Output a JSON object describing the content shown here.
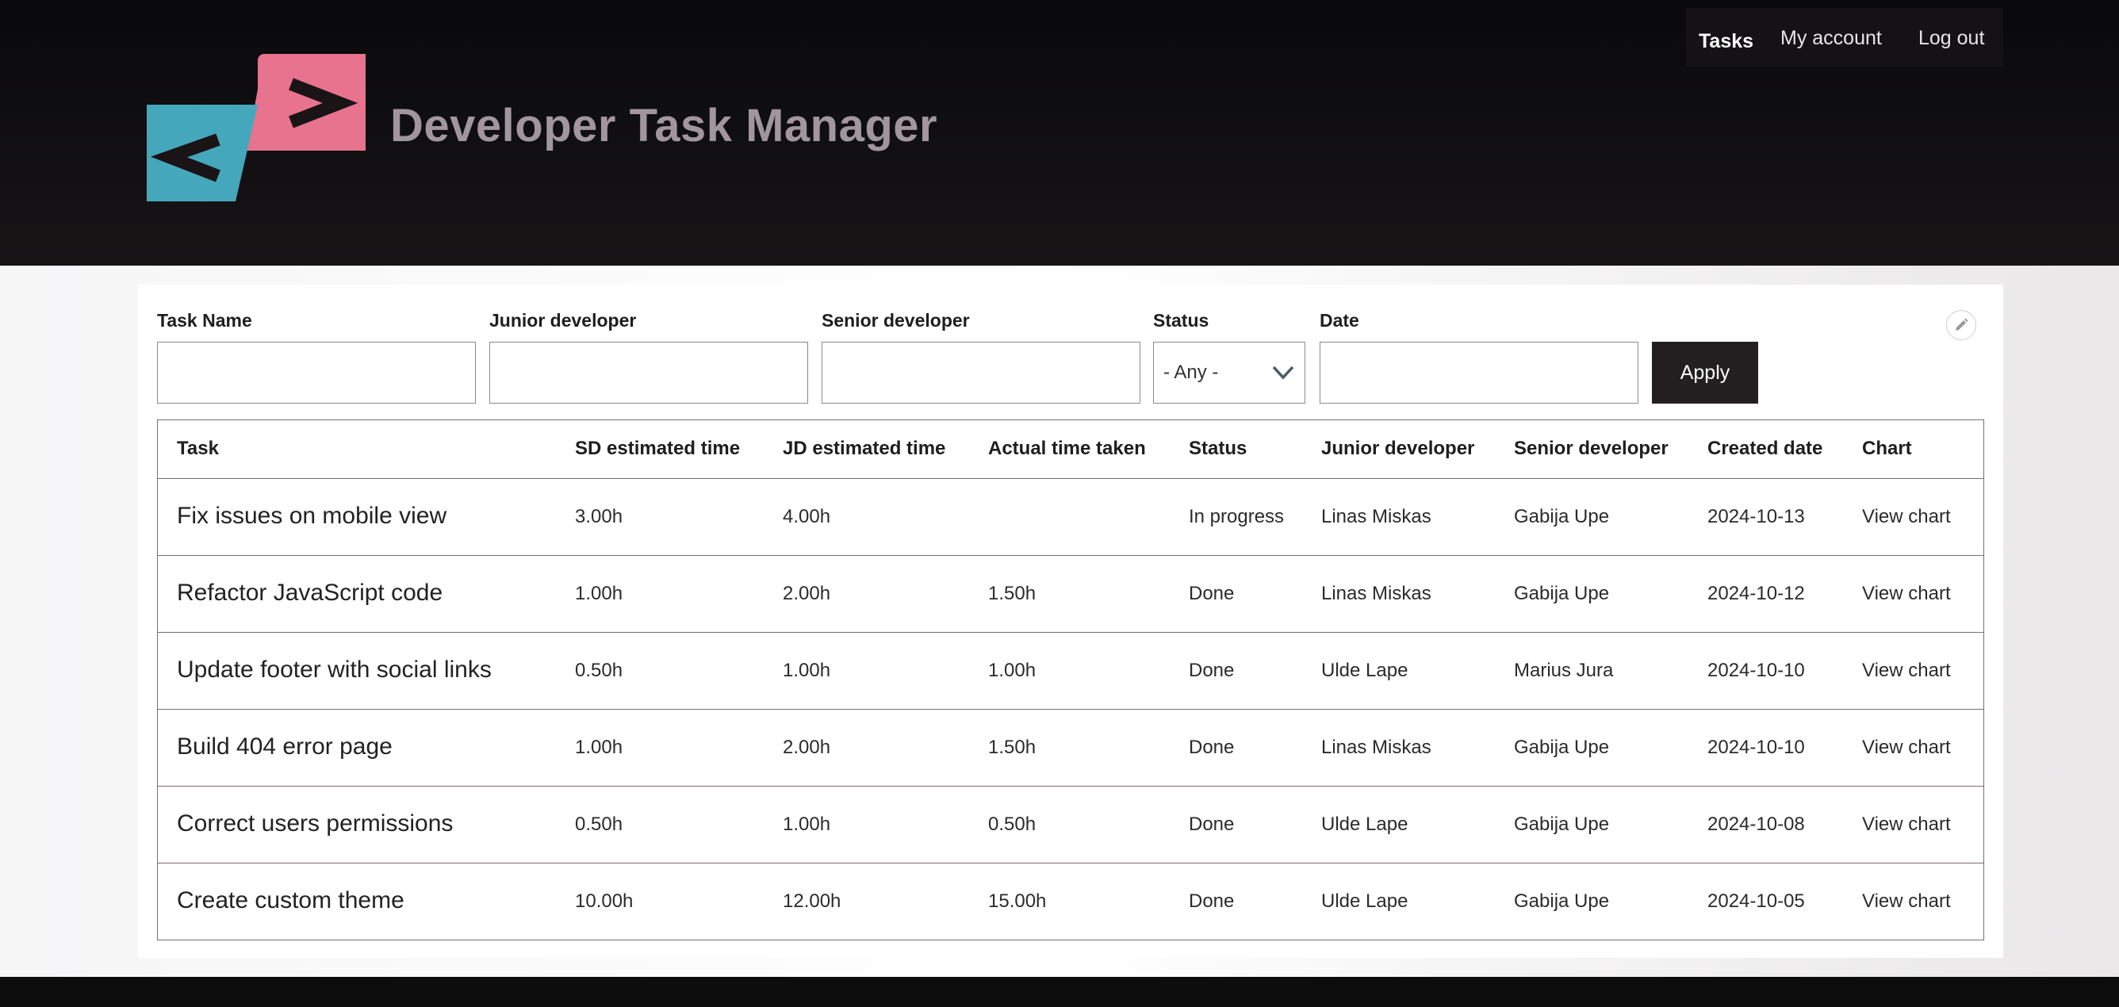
{
  "header": {
    "site_title": "Developer Task Manager",
    "logo": {
      "left_glyph": "<",
      "right_glyph": ">",
      "left_color": "#45a7bb",
      "right_color": "#e7738f"
    },
    "nav": [
      {
        "label": "Tasks",
        "active": true
      },
      {
        "label": "My account",
        "active": false
      },
      {
        "label": "Log out",
        "active": false
      }
    ]
  },
  "filters": {
    "task_name_label": "Task Name",
    "junior_label": "Junior developer",
    "senior_label": "Senior developer",
    "status_label": "Status",
    "status_value": "- Any -",
    "date_label": "Date",
    "apply_label": "Apply"
  },
  "table": {
    "headers": [
      "Task",
      "SD estimated time",
      "JD estimated time",
      "Actual time taken",
      "Status",
      "Junior developer",
      "Senior developer",
      "Created date",
      "Chart"
    ],
    "rows": [
      [
        "Fix issues on mobile view",
        "3.00h",
        "4.00h",
        "",
        "In progress",
        "Linas Miskas",
        "Gabija Upe",
        "2024-10-13",
        "View chart"
      ],
      [
        "Refactor JavaScript code",
        "1.00h",
        "2.00h",
        "1.50h",
        "Done",
        "Linas Miskas",
        "Gabija Upe",
        "2024-10-12",
        "View chart"
      ],
      [
        "Update footer with social links",
        "0.50h",
        "1.00h",
        "1.00h",
        "Done",
        "Ulde Lape",
        "Marius Jura",
        "2024-10-10",
        "View chart"
      ],
      [
        "Build 404 error page",
        "1.00h",
        "2.00h",
        "1.50h",
        "Done",
        "Linas Miskas",
        "Gabija Upe",
        "2024-10-10",
        "View chart"
      ],
      [
        "Correct users permissions",
        "0.50h",
        "1.00h",
        "0.50h",
        "Done",
        "Ulde Lape",
        "Gabija Upe",
        "2024-10-08",
        "View chart"
      ],
      [
        "Create custom theme",
        "10.00h",
        "12.00h",
        "15.00h",
        "Done",
        "Ulde Lape",
        "Gabija Upe",
        "2024-10-05",
        "View chart"
      ]
    ]
  }
}
